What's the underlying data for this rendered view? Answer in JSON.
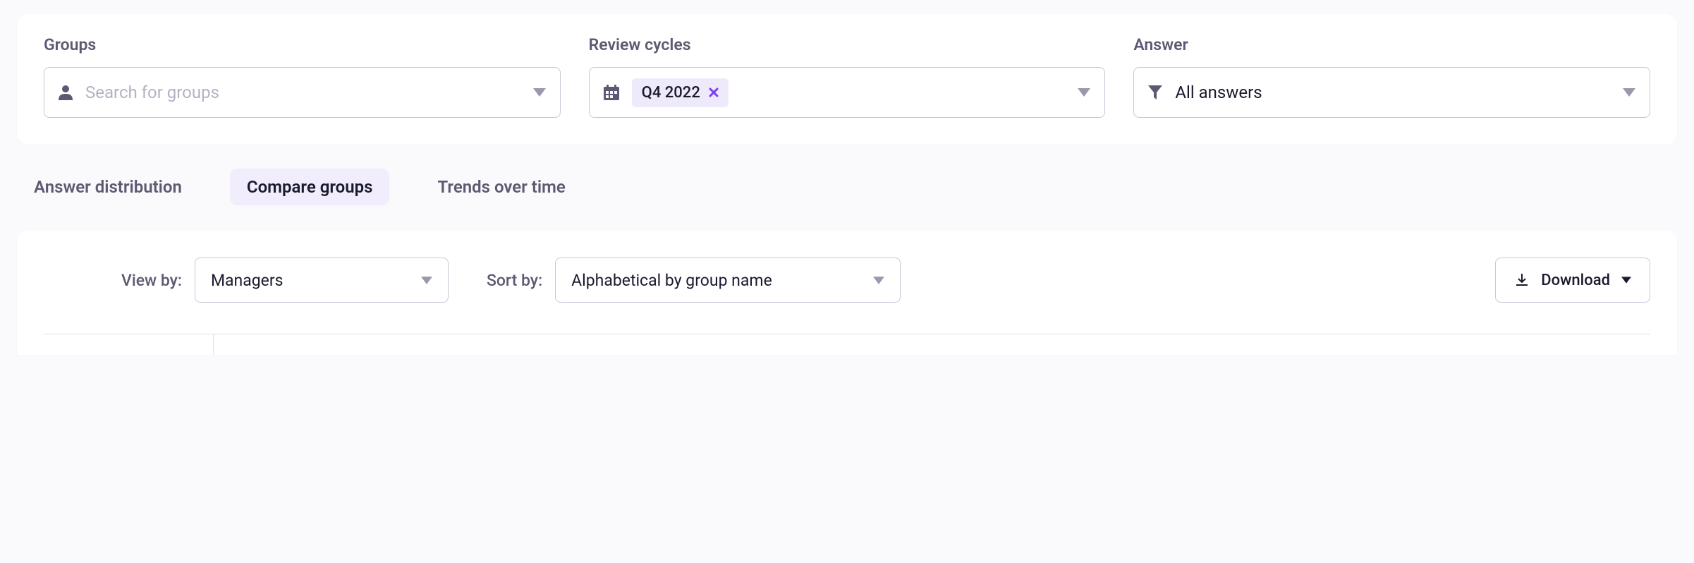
{
  "filters": {
    "groups": {
      "label": "Groups",
      "placeholder": "Search for groups"
    },
    "review_cycles": {
      "label": "Review cycles",
      "chip": "Q4 2022"
    },
    "answer": {
      "label": "Answer",
      "value": "All answers"
    }
  },
  "tabs": {
    "answer_distribution": "Answer distribution",
    "compare_groups": "Compare groups",
    "trends_over_time": "Trends over time"
  },
  "toolbar": {
    "view_by_label": "View by:",
    "view_by_value": "Managers",
    "sort_by_label": "Sort by:",
    "sort_by_value": "Alphabetical by group name",
    "download_label": "Download"
  }
}
